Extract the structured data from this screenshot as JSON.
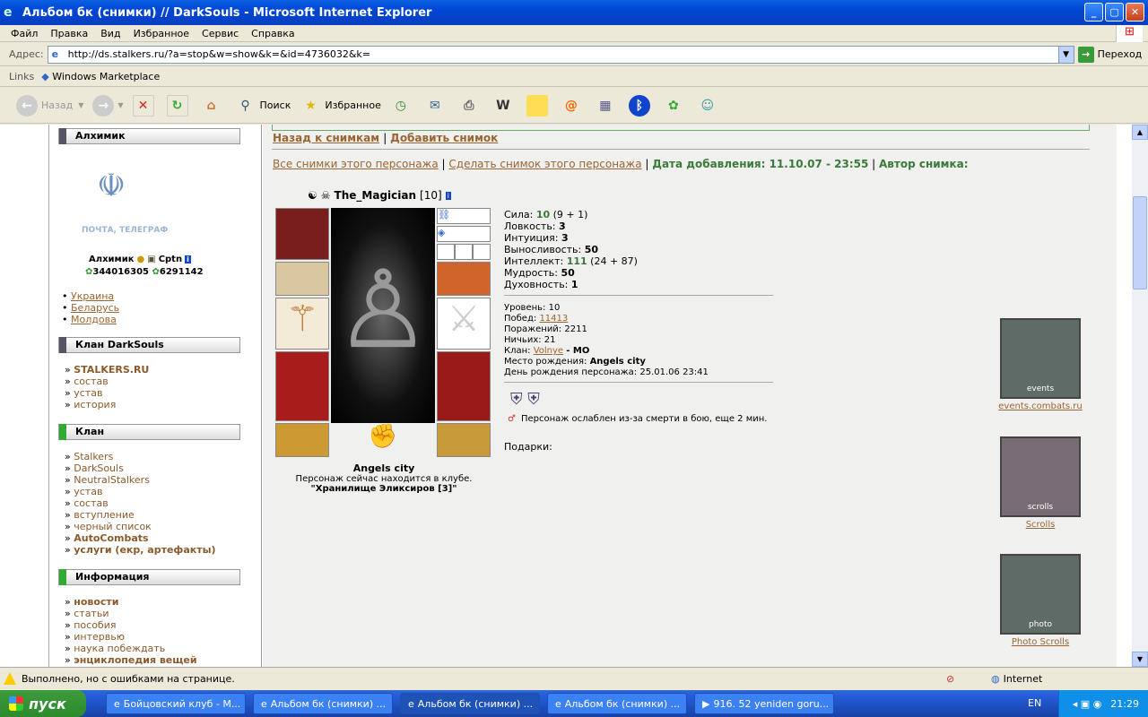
{
  "window": {
    "title": "Альбом бк (снимки) // DarkSouls - Microsoft Internet Explorer"
  },
  "menu": [
    "Файл",
    "Правка",
    "Вид",
    "Избранное",
    "Сервис",
    "Справка"
  ],
  "address": {
    "label": "Адрес:",
    "url": "http://ds.stalkers.ru/?a=stop&w=show&k=&id=4736032&k=",
    "go": "Переход"
  },
  "links": {
    "label": "Links",
    "item": "Windows Marketplace"
  },
  "toolbar": {
    "back": "Назад",
    "search": "Поиск",
    "favorites": "Избранное"
  },
  "sidebar": {
    "alchemist_header": "Алхимик",
    "post_text": "ПОЧТА, ТЕЛЕГРАФ",
    "user_line": "Алхимик",
    "user_line2": "Cptn",
    "icq1": "344016305",
    "icq2": "6291142",
    "countries": [
      "Украина",
      "Беларусь",
      "Молдова"
    ],
    "clan_header": "Клан DarkSouls",
    "clan_items": [
      {
        "t": "STALKERS.RU",
        "b": true
      },
      {
        "t": "состав"
      },
      {
        "t": "устав"
      },
      {
        "t": "история"
      }
    ],
    "klan_header": "Клан",
    "klan_items": [
      {
        "t": "Stalkers"
      },
      {
        "t": "DarkSouls"
      },
      {
        "t": "NeutralStalkers"
      },
      {
        "t": "устав"
      },
      {
        "t": "состав"
      },
      {
        "t": "вступление"
      },
      {
        "t": "черный список"
      },
      {
        "t": "AutoCombats",
        "b": true
      },
      {
        "t": "услуги (екр, артефакты)",
        "b": true
      }
    ],
    "info_header": "Информация",
    "info_items": [
      {
        "t": "новости",
        "b": true
      },
      {
        "t": "статьи"
      },
      {
        "t": "пособия"
      },
      {
        "t": "интервью"
      },
      {
        "t": "наука побеждать"
      },
      {
        "t": "энциклопедия вещей",
        "b": true
      }
    ]
  },
  "main": {
    "back_link": "Назад к снимкам",
    "add_link": "Добавить снимок",
    "all_link": "Все снимки этого персонажа",
    "make_link": "Сделать снимок этого персонажа",
    "date_label": "Дата добавления: 11.10.07 - 23:55",
    "author_label": "Автор снимка:",
    "char_name": "The_Magician",
    "char_level": "[10]",
    "city": "Angels city",
    "location_text": "Персонаж сейчас находится в клубе.",
    "location_room": "\"Хранилище Эликсиров [3]\"",
    "stats": [
      {
        "k": "Сила:",
        "v": "10",
        "x": "(9 + 1)",
        "green": true
      },
      {
        "k": "Ловкость:",
        "v": "3"
      },
      {
        "k": "Интуиция:",
        "v": "3"
      },
      {
        "k": "Выносливость:",
        "v": "50"
      },
      {
        "k": "Интеллект:",
        "v": "111",
        "x": "(24 + 87)",
        "green": true
      },
      {
        "k": "Мудрость:",
        "v": "50"
      },
      {
        "k": "Духовность:",
        "v": "1"
      }
    ],
    "info": {
      "level": "Уровень: 10",
      "wins_label": "Побед:",
      "wins": "11413",
      "losses": "Поражений: 2211",
      "draws": "Ничьих: 21",
      "clan_label": "Клан:",
      "clan": "Volnye",
      "clan_suffix": "- MO",
      "birthplace_label": "Место рождения:",
      "birthplace": "Angels city",
      "birthday": "День рождения персонажа: 25.01.06 23:41"
    },
    "weakened": "Персонаж ослаблен из-за смерти в бою, еще 2 мин.",
    "gifts": "Подарки:",
    "banners": [
      {
        "t": "events.combats.ru",
        "icon": "events"
      },
      {
        "t": "Scrolls",
        "icon": "scrolls"
      },
      {
        "t": "Photo Scrolls",
        "icon": "photo"
      }
    ]
  },
  "status": {
    "text": "Выполнено, но с ошибками на странице.",
    "zone": "Internet"
  },
  "taskbar": {
    "start": "пуск",
    "tasks": [
      "Бойцовский клуб - М...",
      "Альбом бк (снимки) ...",
      "Альбом бк (снимки) ...",
      "Альбом бк (снимки) ...",
      "916. 52 yeniden goru..."
    ],
    "lang": "EN",
    "time": "21:29"
  }
}
